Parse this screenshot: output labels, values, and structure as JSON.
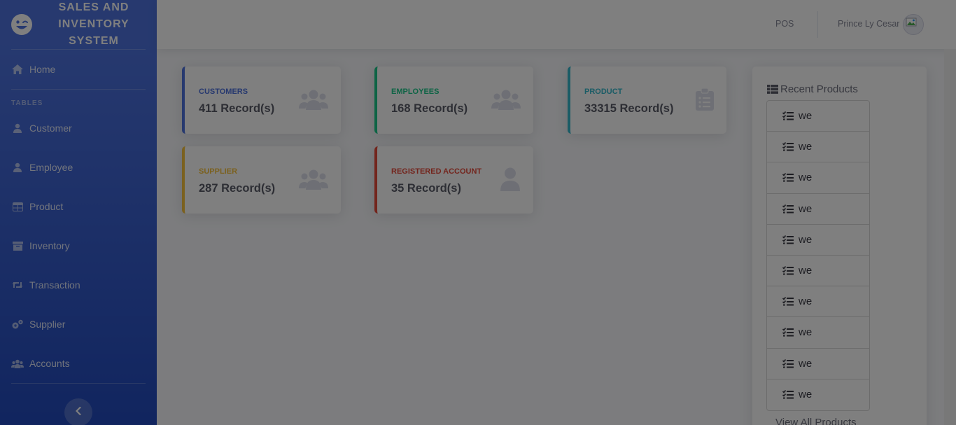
{
  "brand": {
    "title": "SALES AND INVENTORY SYSTEM"
  },
  "sidebar": {
    "home": "Home",
    "heading": "TABLES",
    "items": [
      {
        "label": "Customer",
        "icon": "user-icon"
      },
      {
        "label": "Employee",
        "icon": "user-icon"
      },
      {
        "label": "Product",
        "icon": "table-icon"
      },
      {
        "label": "Inventory",
        "icon": "archive-icon"
      },
      {
        "label": "Transaction",
        "icon": "retweet-icon"
      },
      {
        "label": "Supplier",
        "icon": "cogs-icon"
      },
      {
        "label": "Accounts",
        "icon": "users-icon"
      }
    ],
    "toggle_icon": "chevron-left-icon"
  },
  "topbar": {
    "pos": "POS",
    "user_name": "Prince Ly Cesar"
  },
  "cards": [
    {
      "label": "CUSTOMERS",
      "value": "411 Record(s)",
      "color": "#4e73df",
      "icon": "users-icon"
    },
    {
      "label": "EMPLOYEES",
      "value": "168 Record(s)",
      "color": "#1cc88a",
      "icon": "users-icon"
    },
    {
      "label": "PRODUCT",
      "value": "33315 Record(s)",
      "color": "#36b9cc",
      "icon": "clipboard-list-icon"
    },
    {
      "label": "SUPPLIER",
      "value": "287 Record(s)",
      "color": "#f6c23e",
      "icon": "users-icon"
    },
    {
      "label": "REGISTERED ACCOUNT",
      "value": "35 Record(s)",
      "color": "#e74a3b",
      "icon": "user-icon"
    }
  ],
  "recent_products": {
    "title": "Recent Products",
    "items": [
      "we",
      "we",
      "we",
      "we",
      "we",
      "we",
      "we",
      "we",
      "we",
      "we"
    ],
    "view_all": "View All Products"
  }
}
